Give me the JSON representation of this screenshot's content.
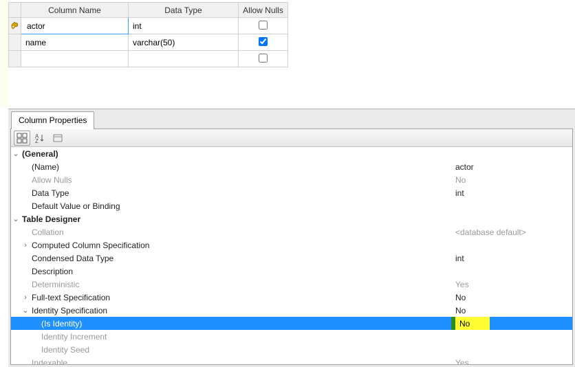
{
  "columnGrid": {
    "headers": {
      "name": "Column Name",
      "type": "Data Type",
      "nulls": "Allow Nulls"
    },
    "rows": [
      {
        "key": true,
        "selected": true,
        "name": "actor",
        "type": "int",
        "nulls": false
      },
      {
        "key": false,
        "selected": false,
        "name": "name",
        "type": "varchar(50)",
        "nulls": true
      },
      {
        "key": false,
        "selected": false,
        "name": "",
        "type": "",
        "nulls": false
      }
    ]
  },
  "propertiesTab": "Column Properties",
  "properties": {
    "general": {
      "title": "(General)",
      "name": {
        "label": "(Name)",
        "value": "actor"
      },
      "allowNulls": {
        "label": "Allow Nulls",
        "value": "No"
      },
      "dataType": {
        "label": "Data Type",
        "value": "int"
      },
      "defaultValue": {
        "label": "Default Value or Binding",
        "value": ""
      }
    },
    "tableDesigner": {
      "title": "Table Designer",
      "collation": {
        "label": "Collation",
        "value": "<database default>"
      },
      "computed": {
        "label": "Computed Column Specification",
        "value": ""
      },
      "condensed": {
        "label": "Condensed Data Type",
        "value": "int"
      },
      "description": {
        "label": "Description",
        "value": ""
      },
      "deterministic": {
        "label": "Deterministic",
        "value": "Yes"
      },
      "fulltext": {
        "label": "Full-text Specification",
        "value": "No"
      },
      "identitySpec": {
        "label": "Identity Specification",
        "value": "No"
      },
      "isIdentity": {
        "label": "(Is Identity)",
        "value": "No"
      },
      "identityIncrement": {
        "label": "Identity Increment",
        "value": ""
      },
      "identitySeed": {
        "label": "Identity Seed",
        "value": ""
      },
      "indexable": {
        "label": "Indexable",
        "value": "Yes"
      }
    }
  }
}
